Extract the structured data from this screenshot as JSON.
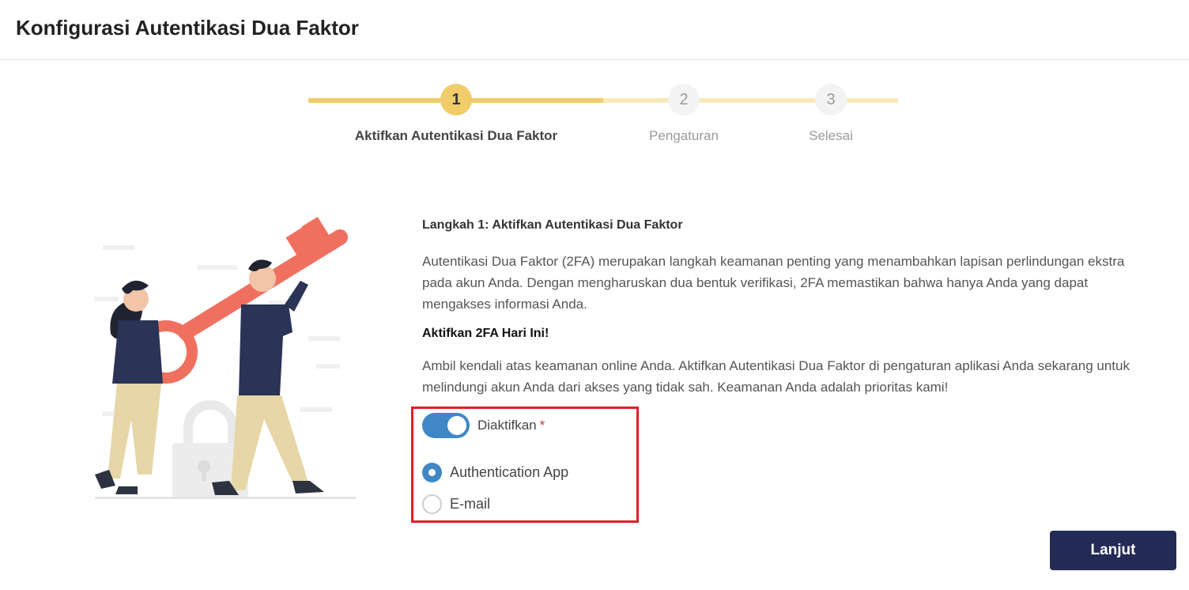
{
  "header": {
    "title": "Konfigurasi Autentikasi Dua Faktor"
  },
  "stepper": {
    "steps": [
      {
        "number": "1",
        "label": "Aktifkan Autentikasi Dua Faktor",
        "state": "active"
      },
      {
        "number": "2",
        "label": "Pengaturan",
        "state": "inactive"
      },
      {
        "number": "3",
        "label": "Selesai",
        "state": "inactive"
      }
    ]
  },
  "content": {
    "step_heading": "Langkah 1: Aktifkan Autentikasi Dua Faktor",
    "intro_line1": "Autentikasi Dua Faktor (2FA) merupakan langkah keamanan penting yang menambahkan lapisan perlindungan ekstra",
    "intro_line2": "pada akun Anda. Dengan mengharuskan dua bentuk verifikasi, 2FA memastikan bahwa hanya Anda yang dapat",
    "intro_line3": "mengakses informasi Anda.",
    "cta_heading": "Aktifkan 2FA Hari Ini!",
    "cta_line1": "Ambil kendali atas keamanan online Anda. Aktifkan Autentikasi Dua Faktor di pengaturan aplikasi Anda sekarang untuk",
    "cta_line2": "melindungi akun Anda dari akses yang tidak sah. Keamanan Anda adalah prioritas kami!"
  },
  "form": {
    "toggle_label": "Diaktifkan",
    "toggle_on": true,
    "required_mark": "*",
    "options": [
      {
        "label": "Authentication App",
        "checked": true
      },
      {
        "label": "E-mail",
        "checked": false
      }
    ]
  },
  "actions": {
    "next_label": "Lanjut"
  },
  "colors": {
    "accent_yellow": "#f0cd6a",
    "toggle_blue": "#3f88c5",
    "button_navy": "#222a55",
    "highlight_red": "#e0202a"
  }
}
